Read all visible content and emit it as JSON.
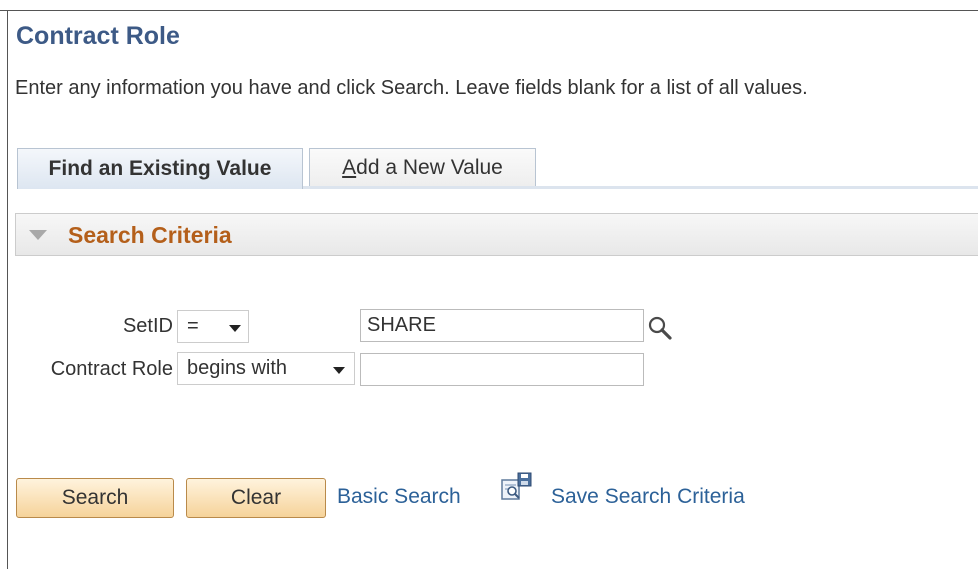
{
  "page": {
    "title": "Contract Role",
    "instructions": "Enter any information you have and click Search. Leave fields blank for a list of all values."
  },
  "tabs": [
    {
      "label": "Find an Existing Value",
      "active": true
    },
    {
      "label_underlined": "A",
      "label_rest": "dd a New Value",
      "active": false
    }
  ],
  "criteria": {
    "title": "Search Criteria",
    "collapse_icon": "triangle-down-icon"
  },
  "fields": {
    "setid": {
      "label": "SetID",
      "operator": "=",
      "value": "SHARE",
      "lookup_icon": "magnifier-icon"
    },
    "contract_role": {
      "label": "Contract Role",
      "operator": "begins with",
      "value": ""
    }
  },
  "actions": {
    "search_label": "Search",
    "clear_label": "Clear",
    "basic_search_label": "Basic Search",
    "save_search_label": "Save Search Criteria",
    "save_icon": "save-search-icon"
  },
  "colors": {
    "title": "#3d5a86",
    "criteria_title": "#b45f1a",
    "link": "#2c6198",
    "button_top": "#fff3dd",
    "button_bottom": "#f6d39a"
  }
}
